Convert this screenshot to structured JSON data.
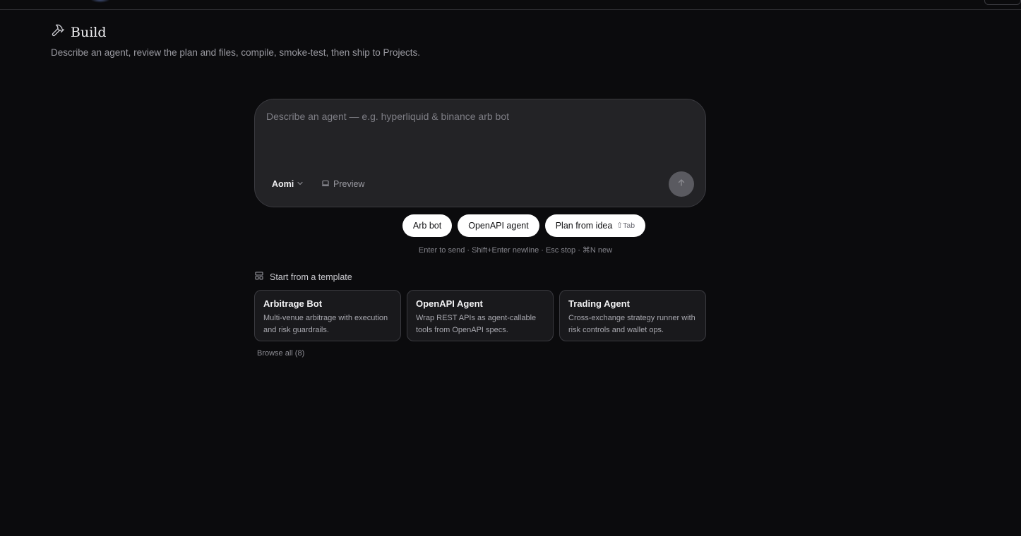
{
  "header": {
    "title": "Build",
    "subtitle": "Describe an agent, review the plan and files, compile, smoke-test, then ship to Projects."
  },
  "composer": {
    "placeholder": "Describe an agent — e.g. hyperliquid & binance arb bot",
    "value": "",
    "model_label": "Aomi",
    "preview_label": "Preview"
  },
  "chips": [
    {
      "label": "Arb bot"
    },
    {
      "label": "OpenAPI agent"
    },
    {
      "label": "Plan from idea",
      "shortcut": "⇧Tab"
    }
  ],
  "hint": "Enter to send · Shift+Enter newline · Esc stop · ⌘N new",
  "templates": {
    "heading": "Start from a template",
    "items": [
      {
        "title": "Arbitrage Bot",
        "description": "Multi-venue arbitrage with execution and risk guardrails."
      },
      {
        "title": "OpenAPI Agent",
        "description": "Wrap REST APIs as agent-callable tools from OpenAPI specs."
      },
      {
        "title": "Trading Agent",
        "description": "Cross-exchange strategy runner with risk controls and wallet ops."
      }
    ],
    "browse_label": "Browse all (8)"
  },
  "icons": {
    "title": "hammer-icon",
    "model": "chevron-down-icon",
    "preview": "laptop-icon",
    "send": "arrow-up-icon",
    "templates": "layout-template-icon"
  }
}
